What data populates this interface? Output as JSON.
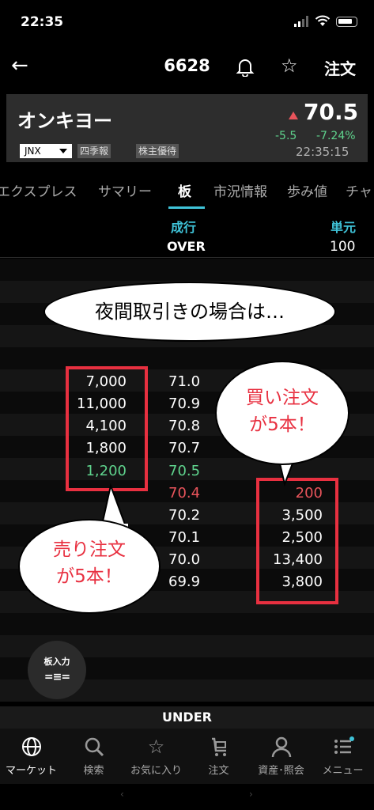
{
  "status": {
    "time": "22:35"
  },
  "nav": {
    "back": "←",
    "code": "6628",
    "order_label": "注文"
  },
  "stock": {
    "name": "オンキヨー",
    "price": "70.5",
    "change": "-5.5",
    "change_pct": "-7.24%",
    "time": "22:35:15",
    "market": "JNX",
    "chips": [
      "四季報",
      "株主優待"
    ]
  },
  "tabs": [
    "エクスプレス",
    "サマリー",
    "板",
    "市況情報",
    "歩み値",
    "チャ"
  ],
  "board": {
    "market_label": "成行",
    "unit_label": "単元",
    "over": "OVER",
    "unit_value": "100",
    "under": "UNDER",
    "rows": [
      {
        "sell": "7,000",
        "price": "71.0",
        "buy": ""
      },
      {
        "sell": "11,000",
        "price": "70.9",
        "buy": ""
      },
      {
        "sell": "4,100",
        "price": "70.8",
        "buy": ""
      },
      {
        "sell": "1,800",
        "price": "70.7",
        "buy": ""
      },
      {
        "sell": "1,200",
        "price": "70.5",
        "buy": ""
      },
      {
        "sell": "",
        "price": "70.4",
        "buy": "200"
      },
      {
        "sell": "",
        "price": "70.2",
        "buy": "3,500"
      },
      {
        "sell": "",
        "price": "70.1",
        "buy": "2,500"
      },
      {
        "sell": "",
        "price": "70.0",
        "buy": "13,400"
      },
      {
        "sell": "",
        "price": "69.9",
        "buy": "3,800"
      }
    ]
  },
  "callouts": {
    "top": "夜間取引きの場合は…",
    "buy_line1": "買い注文",
    "buy_line2": "が5本！",
    "sell_line1": "売り注文",
    "sell_line2": "が5本！"
  },
  "order_input": {
    "label": "板入力",
    "glyph": "=≡="
  },
  "bottom_nav": [
    {
      "label": "マーケット",
      "icon": "globe-icon"
    },
    {
      "label": "検索",
      "icon": "search-icon"
    },
    {
      "label": "お気に入り",
      "icon": "star-icon"
    },
    {
      "label": "注文",
      "icon": "cart-icon"
    },
    {
      "label": "資産･照会",
      "icon": "person-icon"
    },
    {
      "label": "メニュー",
      "icon": "menu-icon"
    }
  ],
  "colors": {
    "accent": "#3fc3d8",
    "down": "#5fd38d",
    "up": "#e8545b",
    "highlight": "#e83040"
  }
}
